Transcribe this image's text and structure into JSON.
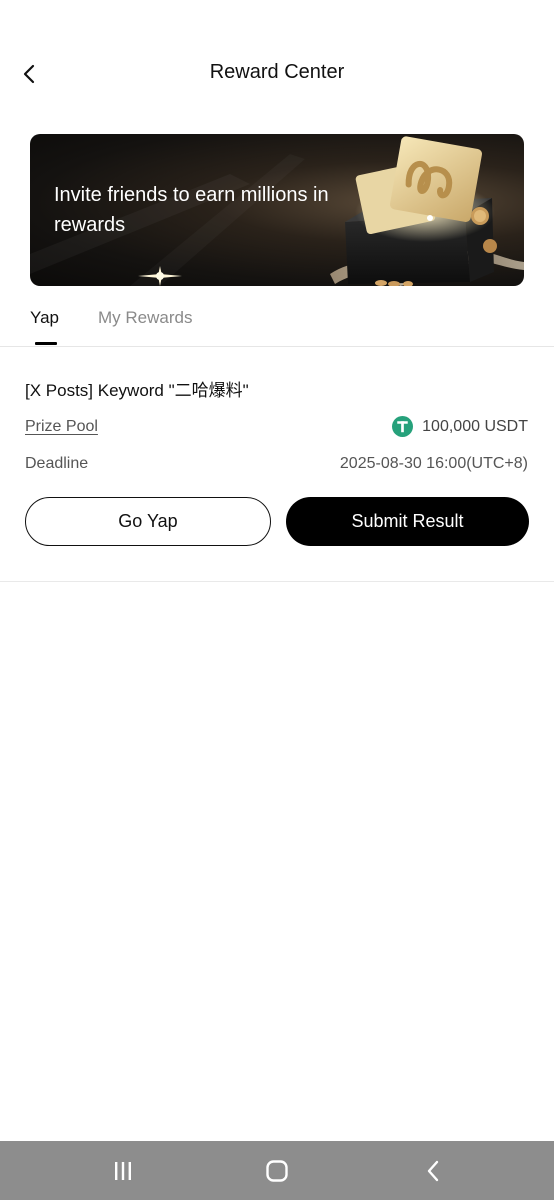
{
  "header": {
    "title": "Reward Center",
    "back_icon": "chevron-left-icon"
  },
  "banner": {
    "text": "Invite friends to earn millions in rewards"
  },
  "tabs": [
    {
      "label": "Yap",
      "active": true
    },
    {
      "label": "My Rewards",
      "active": false
    }
  ],
  "task": {
    "title": "[X Posts] Keyword \"二哈爆料\"",
    "prize_pool_label": "Prize Pool",
    "prize_pool_value": "100,000 USDT",
    "prize_icon": "usdt-tether-icon",
    "deadline_label": "Deadline",
    "deadline_value": "2025-08-30 16:00(UTC+8)",
    "go_button": "Go Yap",
    "submit_button": "Submit Result"
  },
  "navbar": {
    "recent_icon": "recent-apps-icon",
    "home_icon": "home-icon",
    "back_icon": "back-icon"
  },
  "colors": {
    "accent": "#000000",
    "usdt_green": "#26a17b",
    "navbar": "#8d8d8d"
  }
}
